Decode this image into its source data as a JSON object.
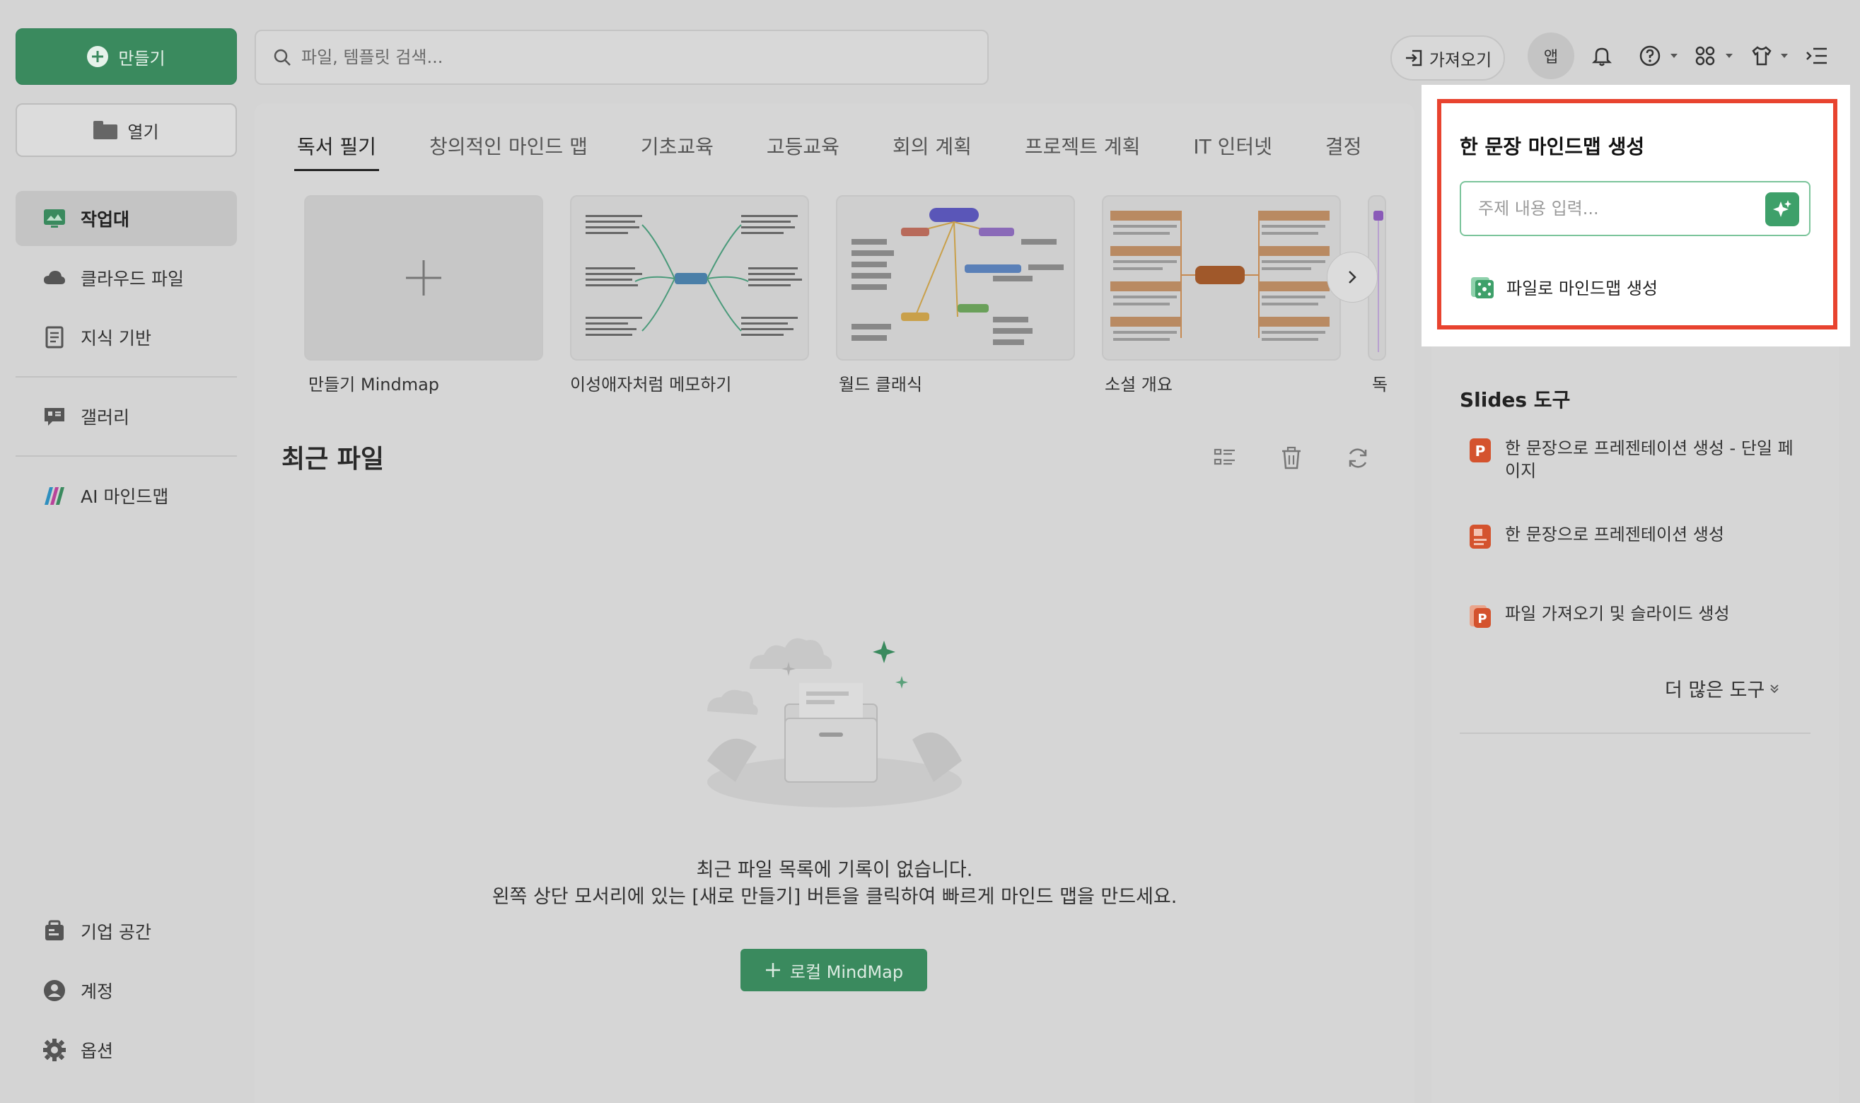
{
  "sidebar": {
    "create_label": "만들기",
    "open_label": "열기",
    "items": [
      {
        "label": "작업대"
      },
      {
        "label": "클라우드 파일"
      },
      {
        "label": "지식 기반"
      },
      {
        "label": "갤러리"
      },
      {
        "label": "AI 마인드맵"
      },
      {
        "label": "기업 공간"
      },
      {
        "label": "계정"
      },
      {
        "label": "옵션"
      }
    ]
  },
  "topbar": {
    "search_placeholder": "파일, 템플릿 검색...",
    "import_label": "가져오기",
    "app_label": "앱"
  },
  "main": {
    "tabs": [
      "독서 필기",
      "창의적인 마인드 맵",
      "기초교육",
      "고등교육",
      "회의 계획",
      "프로젝트 계획",
      "IT 인터넷",
      "결정"
    ],
    "templates": [
      "만들기 Mindmap",
      "이성애자처럼 메모하기",
      "월드 클래식",
      "소설 개요",
      "독"
    ],
    "recent_title": "최근 파일",
    "empty_line1": "최근 파일 목록에 기록이 없습니다.",
    "empty_line2": "왼쪽 상단 모서리에 있는 [새로 만들기] 버튼을 클릭하여 빠르게 마인드 맵을 만드세요.",
    "local_button": "로컬 MindMap"
  },
  "popup": {
    "title": "한 문장 마인드맵 생성",
    "input_placeholder": "주제 내용 입력...",
    "file_link": "파일로 마인드맵 생성"
  },
  "slides": {
    "title": "Slides 도구",
    "items": [
      "한 문장으로 프레젠테이션 생성 - 단일 페이지",
      "한 문장으로 프레젠테이션 생성",
      "파일 가져오기 및 슬라이드 생성"
    ],
    "more_tools": "더 많은 도구"
  },
  "colors": {
    "accent_green": "#3a8a5e",
    "highlight_red": "#e8432f"
  }
}
